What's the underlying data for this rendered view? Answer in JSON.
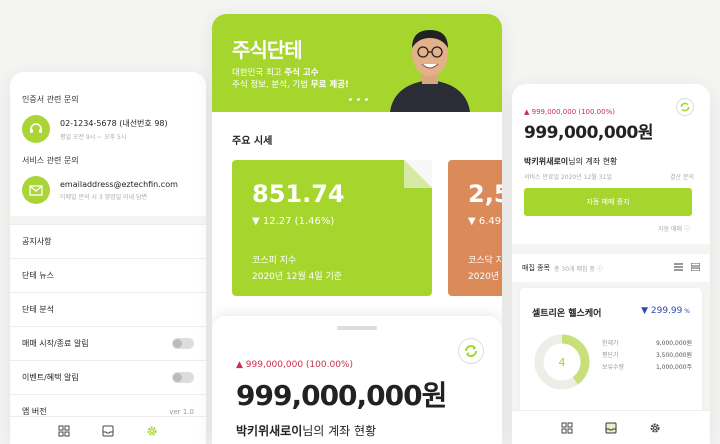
{
  "left": {
    "cert_title": "인증서 관련 문의",
    "phone": "02-1234-5678 (내선번호 98)",
    "phone_hours": "평일 오전 9시 ~ 오후 5시",
    "service_title": "서비스 관련 문의",
    "email": "emailaddress@eztechfin.com",
    "email_note": "이메일 문의 시 3 영업일 이내 답변",
    "menu": [
      "공지사항",
      "단테 뉴스",
      "단테 분석",
      "매매 시작/종료 알림",
      "이벤트/혜택 알림",
      "앱 버전"
    ],
    "version": "ver 1.0"
  },
  "banner": {
    "title": "주식단테",
    "line1_a": "대한민국 최고 ",
    "line1_b": "주식 고수",
    "line2_a": "주식 정보, 분석, 기법 ",
    "line2_b": "무료 제공!"
  },
  "market": {
    "title": "주요 시세",
    "cards": [
      {
        "value": "851.74",
        "change": "▼ 12.27 (1.46%)",
        "index": "코스피 지수",
        "date": "2020년 12월 4일 기준"
      },
      {
        "value": "2,5",
        "change": "▼ 6.49",
        "index": "코스닥 지",
        "date": "2020년"
      }
    ]
  },
  "account": {
    "pct": "999,000,000 (100.00%)",
    "amount": "999,000,000원",
    "owner_name": "박키위새로이",
    "owner_suffix": "님의 계좌 현황"
  },
  "right": {
    "pct": "999,000,000 (100.00%)",
    "amount": "999,000,000원",
    "owner_name": "박키위새로이",
    "owner_suffix": "님의 계좌 현황",
    "sub": "서비스 만료일  2020년 12월 31일",
    "link": "결산 문의",
    "button": "자동 매매 중지",
    "auto": "자동 매매 ⓘ",
    "holdings_title": "매집 종목",
    "holdings_count": "총 30개 매집 중 ⓘ",
    "stock": {
      "name": "셀트리온 헬스케어",
      "price": "▼ 299.99",
      "unit": " %",
      "count": "4",
      "rows": [
        {
          "label": "현재가",
          "value": "9,000,000원"
        },
        {
          "label": "평단가",
          "value": "3,500,000원"
        },
        {
          "label": "보유수량",
          "value": "1,000,000주"
        }
      ]
    }
  },
  "colors": {
    "accent": "#a6d62d",
    "orange": "#db8a5a",
    "red": "#c9304a",
    "blue": "#2e48b7"
  }
}
